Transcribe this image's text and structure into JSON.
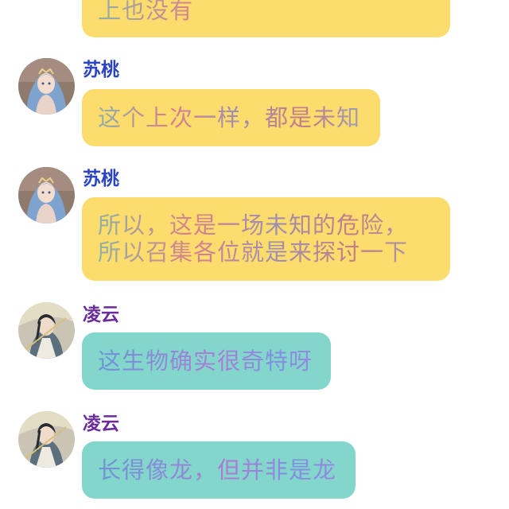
{
  "colors": {
    "bubble_yellow": "#fcdc6c",
    "bubble_teal": "#83d6cb",
    "name_blue": "#2a43c8",
    "name_purple": "#6a2aa0"
  },
  "messages": [
    {
      "sender": "",
      "avatar_icon": "",
      "lines": [
        "上也没有"
      ]
    },
    {
      "sender": "苏桃",
      "avatar_icon": "anime-girl-blue-hair-avatar",
      "lines": [
        "这个上次一样，都是未知"
      ]
    },
    {
      "sender": "苏桃",
      "avatar_icon": "anime-girl-blue-hair-avatar",
      "lines": [
        "所以，这是一场未知的危险，",
        "所以召集各位就是来探讨一下"
      ]
    },
    {
      "sender": "凌云",
      "avatar_icon": "anime-swordsman-avatar",
      "lines": [
        "这生物确实很奇特呀"
      ]
    },
    {
      "sender": "凌云",
      "avatar_icon": "anime-swordsman-avatar",
      "lines": [
        "长得像龙，但并非是龙"
      ]
    }
  ]
}
